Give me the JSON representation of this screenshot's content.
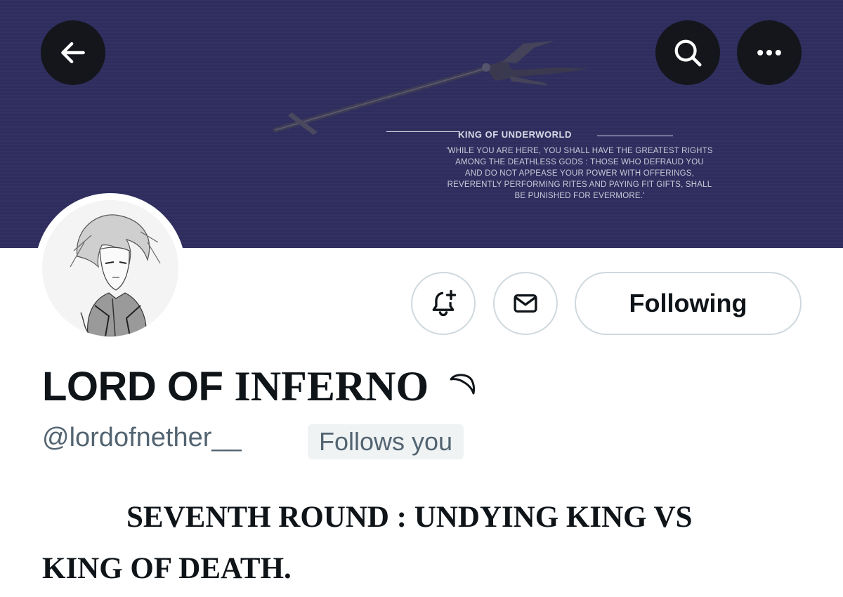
{
  "banner": {
    "title": "KING OF UNDERWORLD",
    "quote": "'WHILE YOU ARE HERE, YOU SHALL HAVE THE GREATEST RIGHTS AMONG THE DEATHLESS GODS : THOSE WHO DEFRAUD YOU AND DO NOT APPEASE YOUR POWER WITH OFFERINGS, REVERENTLY PERFORMING RITES AND PAYING FIT GIFTS, SHALL BE PUNISHED FOR EVERMORE.'",
    "background_color": "#2e2d5e",
    "art": "trident-illustration"
  },
  "nav": {
    "back_icon": "arrow-left-icon",
    "search_icon": "search-icon",
    "more_icon": "more-horizontal-icon"
  },
  "profile": {
    "avatar": "anime-character-portrait",
    "display_name_part1": "LORD OF",
    "display_name_part2": "INFERNO",
    "name_emoji": "crescent-moon-icon",
    "handle": "@lordofnether__",
    "follows_you_badge": "Follows you",
    "bio": "SEVENTH ROUND : UNDYING KING VS KING OF DEATH."
  },
  "actions": {
    "notify_icon": "bell-plus-icon",
    "message_icon": "mail-icon",
    "following_label": "Following"
  }
}
